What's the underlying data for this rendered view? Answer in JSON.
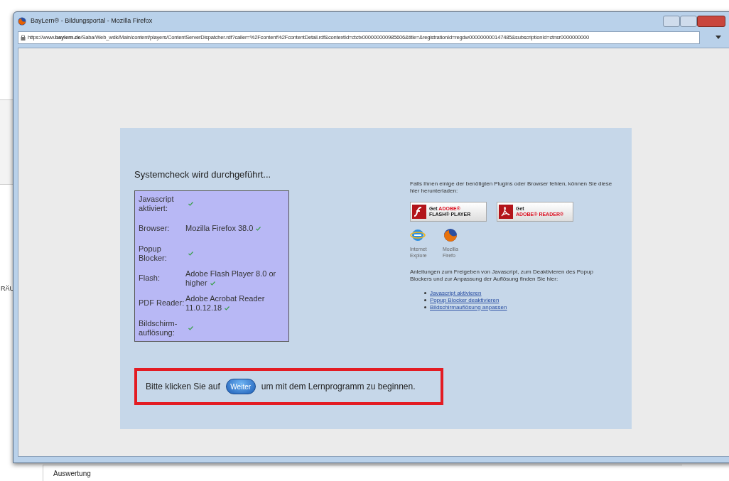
{
  "background": {
    "side_label": "RÄU",
    "section_label": "Auswertung"
  },
  "window": {
    "title": "BayLern® - Bildungsportal - Mozilla Firefox",
    "url": "https://www.**baylern.de**/Saba/Web_wdk/Main/content/players/ContentServerDispatcher.rdf?caller=%2Fcontent%2FcontentDetail.rdf&contextId=ctctx000000000985606&title=&registrationId=regdw000000000147485&subscriptionId=ctnsr0000000000"
  },
  "check": {
    "heading": "Systemcheck wird durchgeführt...",
    "rows": [
      {
        "label": "Javascript aktiviert:",
        "value": "",
        "checked": true
      },
      {
        "label": "Browser:",
        "value": "Mozilla Firefox 38.0",
        "checked": true
      },
      {
        "label": "Popup Blocker:",
        "value": "",
        "checked": true
      },
      {
        "label": "Flash:",
        "value": "Adobe Flash Player 8.0 or higher",
        "checked": true
      },
      {
        "label": "PDF Reader:",
        "value": "Adobe Acrobat Reader 11.0.12.18",
        "checked": true
      },
      {
        "label": "Bildschirm-auflösung:",
        "value": "",
        "checked": true
      }
    ]
  },
  "downloads": {
    "intro": "Falls Ihnen einige der benötigten Plugins oder Browser fehlen, können Sie diese hier herunterladen:",
    "badges": [
      {
        "kind": "flash",
        "line1": "Get",
        "line1_accent": "ADOBE®",
        "line2": "FLASH® PLAYER"
      },
      {
        "kind": "reader",
        "line1": "Get",
        "line2": "ADOBE® READER®"
      }
    ],
    "browsers": [
      {
        "kind": "ie",
        "line1": "Internet",
        "line2": "Explore"
      },
      {
        "kind": "firefox",
        "line1": "Mozilla",
        "line2": "Firefo"
      }
    ],
    "help": "Anleitungen zum Freigeben von Javascript, zum Deaktivieren des Popup Blockers und zur Anpassung der Auflösung finden Sie hier:",
    "links": [
      "Javascript aktivieren",
      "Popup Blocker deaktivieren",
      "Bildschirmauflösung anpassen"
    ]
  },
  "prompt": {
    "before": "Bitte klicken Sie auf",
    "button": "Weiter",
    "after": "um mit dem Lernprogramm zu beginnen."
  }
}
